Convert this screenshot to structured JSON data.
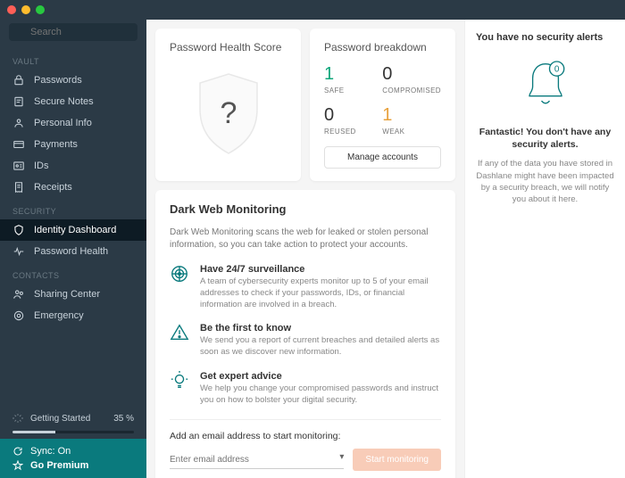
{
  "search": {
    "placeholder": "Search"
  },
  "sidebar": {
    "sections": {
      "vault": "VAULT",
      "security": "SECURITY",
      "contacts": "CONTACTS"
    },
    "items": {
      "passwords": "Passwords",
      "secure_notes": "Secure Notes",
      "personal_info": "Personal Info",
      "payments": "Payments",
      "ids": "IDs",
      "receipts": "Receipts",
      "identity_dashboard": "Identity Dashboard",
      "password_health": "Password Health",
      "sharing_center": "Sharing Center",
      "emergency": "Emergency"
    },
    "getting_started": {
      "label": "Getting Started",
      "pct": "35 %",
      "pct_value": 35
    },
    "sync": {
      "label": "Sync: On"
    },
    "premium": {
      "label": "Go Premium"
    }
  },
  "score": {
    "title": "Password Health Score",
    "mark": "?"
  },
  "breakdown": {
    "title": "Password breakdown",
    "safe": {
      "num": "1",
      "lab": "SAFE"
    },
    "compromised": {
      "num": "0",
      "lab": "COMPROMISED"
    },
    "reused": {
      "num": "0",
      "lab": "REUSED"
    },
    "weak": {
      "num": "1",
      "lab": "WEAK"
    },
    "manage": "Manage accounts"
  },
  "dark": {
    "title": "Dark Web Monitoring",
    "desc": "Dark Web Monitoring scans the web for leaked or stolen personal information, so you can take action to protect your accounts.",
    "features": {
      "surv": {
        "title": "Have 24/7 surveillance",
        "desc": "A team of cybersecurity experts monitor up to 5 of your email addresses to check if your passwords, IDs, or financial information are involved in a breach."
      },
      "first": {
        "title": "Be the first to know",
        "desc": "We send you a report of current breaches and detailed alerts as soon as we discover new information."
      },
      "expert": {
        "title": "Get expert advice",
        "desc": "We help you change your compromised passwords and instruct you on how to bolster your digital security."
      }
    },
    "email_label": "Add an email address to start monitoring:",
    "email_placeholder": "Enter email address",
    "start": "Start monitoring"
  },
  "alerts": {
    "title": "You have no security alerts",
    "badge": "0",
    "head": "Fantastic! You don't have any security alerts.",
    "body": "If any of the data you have stored in Dashlane might have been impacted by a security breach, we will notify you about it here."
  }
}
